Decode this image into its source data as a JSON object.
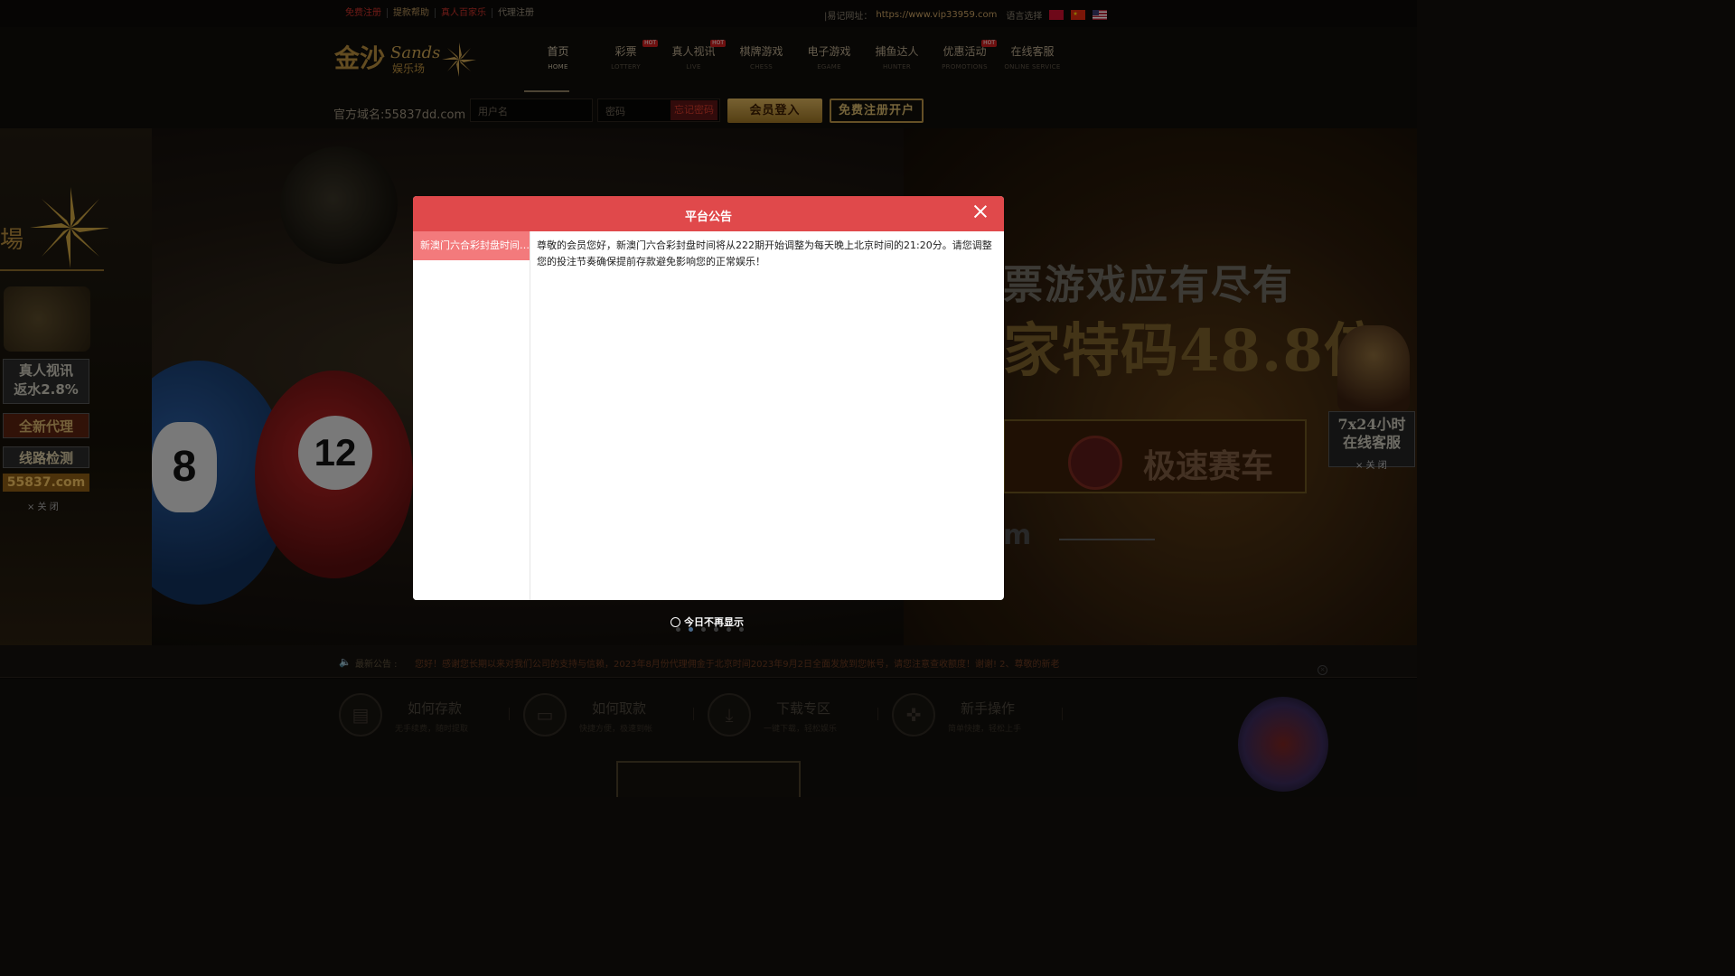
{
  "topbar": {
    "links": [
      "免费注册",
      "提款帮助",
      "真人百家乐",
      "代理注册"
    ],
    "url_label": "|易记网址：",
    "url": "https://www.vip33959.com",
    "lang_label": "语言选择",
    "flags": [
      "hk",
      "cn",
      "us"
    ]
  },
  "logo": {
    "text": "金沙",
    "sub": "娱乐场",
    "brand": "Sands"
  },
  "nav": [
    {
      "zh": "首页",
      "en": "HOME",
      "hot": false
    },
    {
      "zh": "彩票",
      "en": "LOTTERY",
      "hot": true
    },
    {
      "zh": "真人视讯",
      "en": "LIVE",
      "hot": true
    },
    {
      "zh": "棋牌游戏",
      "en": "CHESS",
      "hot": false
    },
    {
      "zh": "电子游戏",
      "en": "EGAME",
      "hot": false
    },
    {
      "zh": "捕鱼达人",
      "en": "HUNTER",
      "hot": false
    },
    {
      "zh": "优惠活动",
      "en": "PROMOTIONS",
      "hot": true
    },
    {
      "zh": "在线客服",
      "en": "ONLINE SERVICE",
      "hot": false
    }
  ],
  "hot_label": "HOT",
  "login": {
    "domain_label": "官方域名:55837dd.com",
    "username_placeholder": "用户名",
    "password_placeholder": "密码",
    "forgot": "忘记密码",
    "login_button": "会员登入",
    "register_button": "免费注册开户"
  },
  "banner": {
    "line1": "票游戏应有尽有",
    "line2": "家特码48.8倍",
    "pill_text": "极速赛车",
    "tail": "m",
    "ball_numbers": [
      "8",
      "12"
    ]
  },
  "left_ad": {
    "live": "真人视讯",
    "rebate": "返水2.8%",
    "agent": "全新代理",
    "check": "线路检测",
    "domain": "55837.com",
    "close": "× 关 闭"
  },
  "right_ad": {
    "line1": "7x24小时",
    "line2": "在线客服",
    "close": "× 关 闭"
  },
  "notice": {
    "label": "最新公告 :",
    "text": "您好！感谢您长期以来对我们公司的支持与信赖，2023年8月份代理佣金于北京时间2023年9月2日全面发放到您帐号，请您注意查收额度！谢谢!      2、尊敬的新老"
  },
  "features": [
    {
      "title": "如何存款",
      "sub": "无手续费，随时提取",
      "icon": "deposit-icon"
    },
    {
      "title": "如何取款",
      "sub": "快捷方便，极速到帐",
      "icon": "card-icon"
    },
    {
      "title": "下载专区",
      "sub": "一键下载，轻松娱乐",
      "icon": "download-icon"
    },
    {
      "title": "新手操作",
      "sub": "简单快捷，轻松上手",
      "icon": "gamepad-icon"
    }
  ],
  "modal": {
    "title": "平台公告",
    "side_item": "新澳门六合彩封盘时间调整",
    "content": "尊敬的会员您好，新澳门六合彩封盘时间将从222期开始调整为每天晚上北京时间的21:20分。请您调整您的投注节奏确保提前存款避免影响您的正常娱乐！",
    "dont_show": "今日不再显示"
  },
  "colors": {
    "modal_header": "#e0494b",
    "side_item": "#f37a7c",
    "gold": "#d9b15b"
  }
}
